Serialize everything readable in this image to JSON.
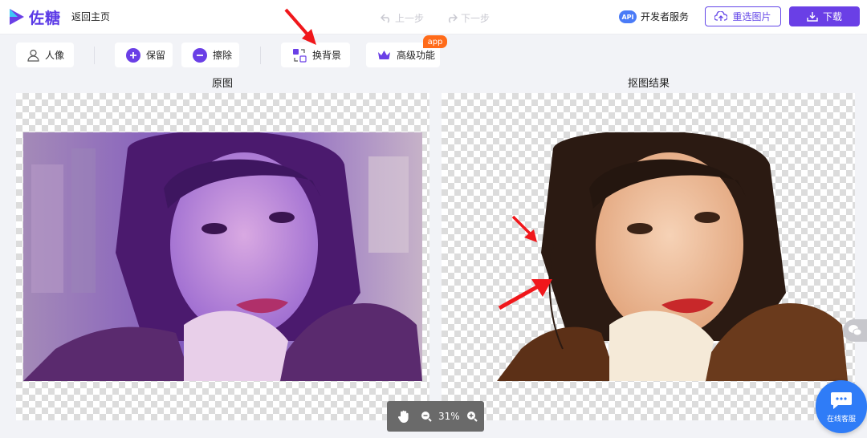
{
  "app": {
    "brand": "佐糖",
    "back_label": "返回主页"
  },
  "header": {
    "undo_label": "上一步",
    "redo_label": "下一步",
    "api_badge": "API",
    "developer_label": "开发者服务",
    "reselect_label": "重选图片",
    "download_label": "下载"
  },
  "toolbar": {
    "person_label": "人像",
    "keep_label": "保留",
    "erase_label": "擦除",
    "change_bg_label": "换背景",
    "advanced_label": "高级功能",
    "app_badge": "app"
  },
  "panels": {
    "original_title": "原图",
    "result_title": "抠图结果"
  },
  "zoom": {
    "level": "31%"
  },
  "support": {
    "label": "在线客服"
  },
  "colors": {
    "accent": "#6a3fe6",
    "accent_blue": "#2f7cf7",
    "badge_orange": "#ff6b1a",
    "arrow_red": "#f0171b"
  }
}
